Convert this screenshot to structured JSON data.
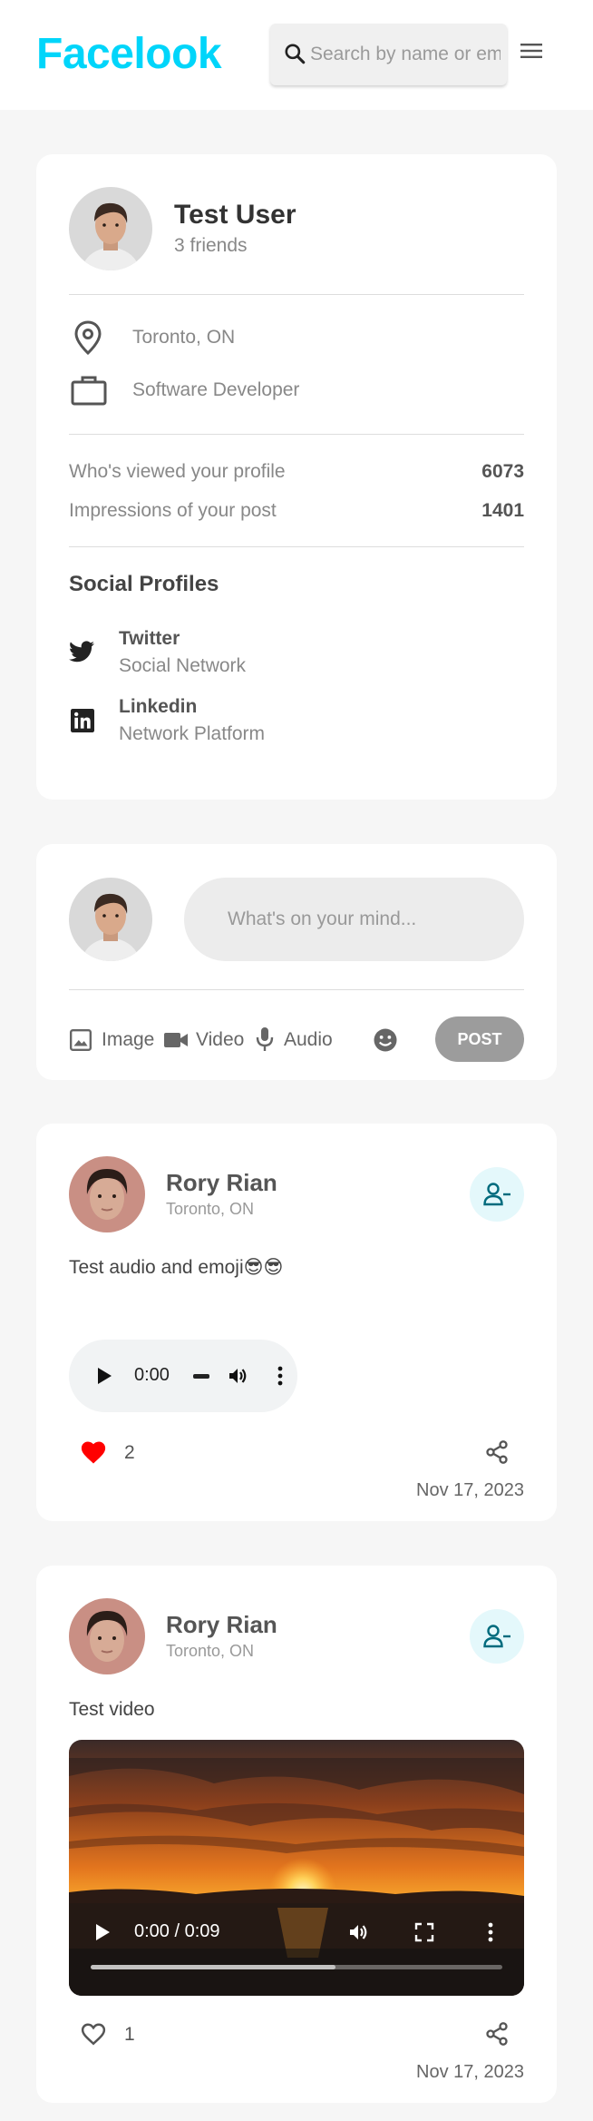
{
  "nav": {
    "logo": "Facelook",
    "search_placeholder": "Search by name or email"
  },
  "profile": {
    "name": "Test User",
    "friends": "3 friends",
    "location": "Toronto, ON",
    "occupation": "Software Developer",
    "stats": [
      {
        "label": "Who's viewed your profile",
        "value": "6073"
      },
      {
        "label": "Impressions of your post",
        "value": "1401"
      }
    ],
    "social_title": "Social Profiles",
    "socials": [
      {
        "name": "Twitter",
        "type": "Social Network",
        "icon": "twitter-icon"
      },
      {
        "name": "Linkedin",
        "type": "Network Platform",
        "icon": "linkedin-icon"
      }
    ]
  },
  "composer": {
    "placeholder": "What's on your mind...",
    "actions": [
      "Image",
      "Video",
      "Audio"
    ],
    "post_label": "POST"
  },
  "posts": [
    {
      "author": "Rory Rian",
      "location": "Toronto, ON",
      "text": "Test audio and emoji😎😎",
      "media": "audio",
      "media_time": "0:00",
      "likes": "2",
      "liked": true,
      "date": "Nov 17, 2023"
    },
    {
      "author": "Rory Rian",
      "location": "Toronto, ON",
      "text": "Test video",
      "media": "video",
      "media_time": "0:00 / 0:09",
      "likes": "1",
      "liked": false,
      "date": "Nov 17, 2023"
    }
  ],
  "colors": {
    "brand": "#00d5fa",
    "like": "#ff0000",
    "friend_button_bg": "#e4f8fb",
    "friend_icon": "#006b7d"
  }
}
